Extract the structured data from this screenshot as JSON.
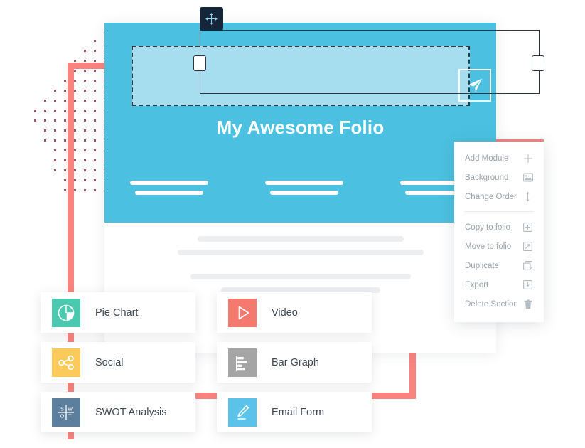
{
  "hero": {
    "title": "My Awesome Folio",
    "send_icon": "paper-plane-icon",
    "drag_handle_icon": "move-arrows-icon",
    "columns": [
      {
        "bars": 2
      },
      {
        "bars": 2
      },
      {
        "bars": 2
      }
    ]
  },
  "context_menu": {
    "group_one": [
      {
        "label": "Add Module",
        "icon": "plus-icon"
      },
      {
        "label": "Background",
        "icon": "image-icon"
      },
      {
        "label": "Change Order",
        "icon": "updown-arrow-icon"
      }
    ],
    "group_two": [
      {
        "label": "Copy to folio",
        "icon": "box-plus-icon"
      },
      {
        "label": "Move to folio",
        "icon": "box-arrow-icon"
      },
      {
        "label": "Duplicate",
        "icon": "duplicate-icon"
      },
      {
        "label": "Export",
        "icon": "download-icon"
      },
      {
        "label": "Delete Section",
        "icon": "trash-icon"
      }
    ]
  },
  "modules": [
    {
      "label": "Pie Chart",
      "icon": "pie-chart-icon",
      "color": "#4bc9ae"
    },
    {
      "label": "Social",
      "icon": "share-icon",
      "color": "#fbca5a"
    },
    {
      "label": "SWOT Analysis",
      "icon": "swot-grid-icon",
      "color": "#5d7f9e"
    },
    {
      "label": "Video",
      "icon": "play-icon",
      "color": "#f4796f"
    },
    {
      "label": "Bar Graph",
      "icon": "bar-graph-icon",
      "color": "#a5a5a5"
    },
    {
      "label": "Email Form",
      "icon": "pencil-icon",
      "color": "#5bc3ea"
    }
  ],
  "swot_icon_letters": {
    "top_left": "S",
    "top_right": "W",
    "bottom_left": "O",
    "bottom_right": "T"
  },
  "colors": {
    "hero_blue": "#4bc0e0",
    "hero_inner_blue": "#a6def0",
    "ribbon_pink": "#f9837f",
    "selection_dark": "#2b3440",
    "drag_chip": "#16263a",
    "menu_text": "#9aa3ab",
    "card_text": "#3d4852",
    "dot": "#8f3b44"
  }
}
